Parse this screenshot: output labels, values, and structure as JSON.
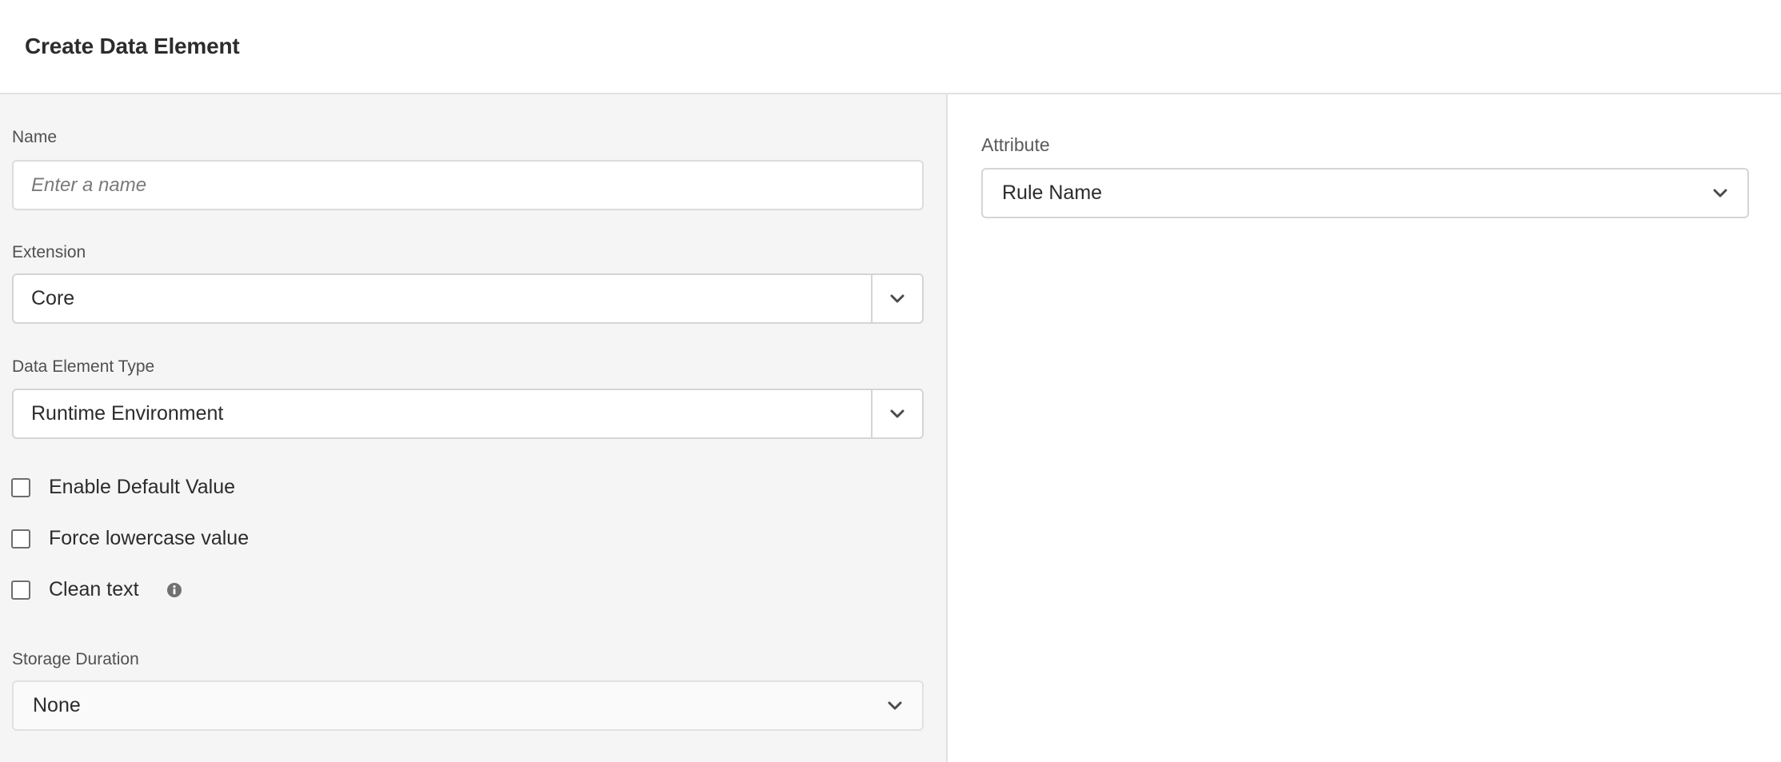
{
  "header": {
    "title": "Create Data Element"
  },
  "form": {
    "name": {
      "label": "Name",
      "placeholder": "Enter a name",
      "value": ""
    },
    "extension": {
      "label": "Extension",
      "value": "Core",
      "icon": "chevron-down-icon"
    },
    "data_element_type": {
      "label": "Data Element Type",
      "value": "Runtime Environment",
      "icon": "chevron-down-icon"
    },
    "checkboxes": [
      {
        "label": "Enable Default Value",
        "checked": false
      },
      {
        "label": "Force lowercase value",
        "checked": false
      },
      {
        "label": "Clean text",
        "checked": false,
        "icon": "info-icon"
      }
    ],
    "storage_duration": {
      "label": "Storage Duration",
      "value": "None",
      "icon": "chevron-down-icon"
    }
  },
  "settings": {
    "attribute": {
      "label": "Attribute",
      "value": "Rule Name",
      "icon": "chevron-down-icon"
    }
  },
  "colors": {
    "left_pane_bg": "#f5f5f5",
    "divider": "#e1e1e1",
    "text": "#2c2c2c",
    "label": "#505050"
  }
}
